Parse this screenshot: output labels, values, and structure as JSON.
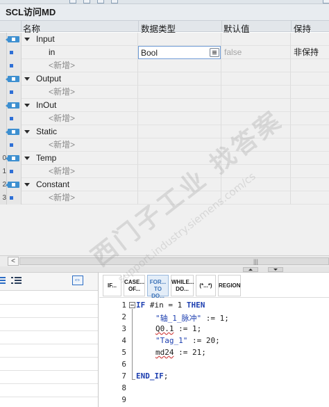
{
  "block": {
    "title": "SCL访问MD"
  },
  "columns": {
    "name": "名称",
    "datatype": "数据类型",
    "default": "默认值",
    "retain": "保持"
  },
  "interface": {
    "rows": [
      {
        "kind": "section",
        "num": "",
        "label": "Input"
      },
      {
        "kind": "param",
        "num": "",
        "label": "in",
        "datatype": "Bool",
        "default": "false",
        "retain": "非保持",
        "selected": true
      },
      {
        "kind": "new",
        "num": "",
        "label": "<新增>"
      },
      {
        "kind": "section",
        "num": "",
        "label": "Output"
      },
      {
        "kind": "new",
        "num": "",
        "label": "<新增>"
      },
      {
        "kind": "section",
        "num": "",
        "label": "InOut"
      },
      {
        "kind": "new",
        "num": "",
        "label": "<新增>"
      },
      {
        "kind": "section",
        "num": "",
        "label": "Static"
      },
      {
        "kind": "new",
        "num": "",
        "label": "<新增>"
      },
      {
        "kind": "section",
        "num": "0",
        "label": "Temp"
      },
      {
        "kind": "new",
        "num": "1",
        "label": "<新增>"
      },
      {
        "kind": "section",
        "num": "2",
        "label": "Constant"
      },
      {
        "kind": "new",
        "num": "3",
        "label": "<新增>"
      }
    ]
  },
  "scroll": {
    "left_arrow": "<",
    "grip": "|||"
  },
  "toolbar": {
    "buttons": [
      {
        "line1": "IF...",
        "line2": "",
        "name": "if"
      },
      {
        "line1": "CASE...",
        "line2": "OF...",
        "name": "case"
      },
      {
        "line1": "FOR...",
        "line2": "TO DO...",
        "name": "for"
      },
      {
        "line1": "WHILE...",
        "line2": "DO...",
        "name": "while"
      },
      {
        "line1": "(*...*)",
        "line2": "",
        "name": "comment"
      },
      {
        "line1": "REGION",
        "line2": "",
        "name": "region"
      }
    ]
  },
  "code": {
    "line_numbers": [
      "1",
      "2",
      "3",
      "4",
      "5",
      "6",
      "7",
      "8",
      "9"
    ],
    "lines": [
      {
        "kw1": "IF",
        "t1": " #in = 1 ",
        "kw2": "THEN"
      },
      {
        "s": "\"轴_1_脉冲\"",
        "t": " := 1;"
      },
      {
        "v": "Q0.1",
        "t": " := 1;"
      },
      {
        "s": "\"Tag_1\"",
        "t": " := 20;"
      },
      {
        "v": "md24",
        "t": " := 21;"
      },
      {
        "t": ""
      },
      {
        "kw1": "END_IF",
        "t1": ";"
      }
    ]
  },
  "watermark": {
    "cn": "西门子工业  找答案",
    "url": "support.industry.siemens.com/cs"
  },
  "colors": {
    "accent": "#3d8fd0",
    "keyword": "#1d3fb0",
    "selection": "#e3edf8"
  }
}
